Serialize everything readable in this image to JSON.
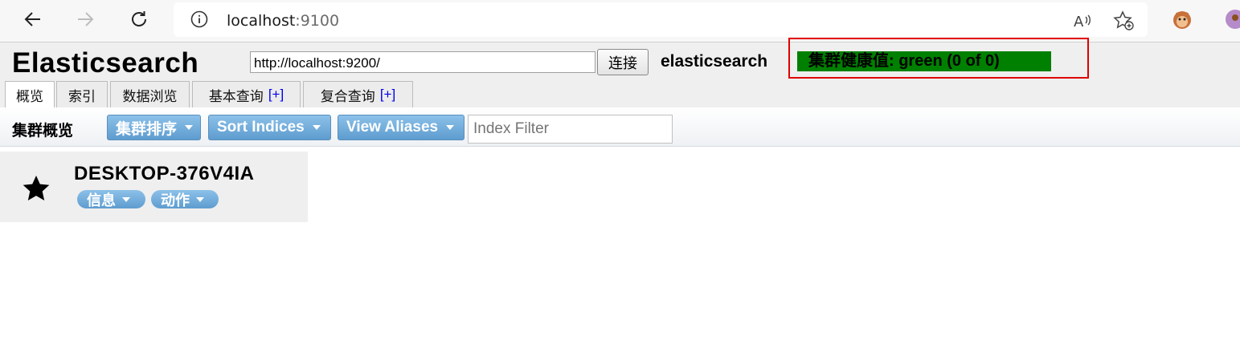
{
  "browser": {
    "url_host": "localhost",
    "url_port": ":9100"
  },
  "app": {
    "brand": "Elasticsearch",
    "connect_url": "http://localhost:9200/",
    "connect_label": "连接",
    "cluster_name": "elasticsearch",
    "health_text": "集群健康值: green (0 of 0)",
    "health_color": "#008000",
    "tabs": [
      {
        "label": "概览",
        "plus": ""
      },
      {
        "label": "索引",
        "plus": ""
      },
      {
        "label": "数据浏览",
        "plus": ""
      },
      {
        "label": "基本查询",
        "plus": "[+]"
      },
      {
        "label": "复合查询",
        "plus": "[+]"
      }
    ]
  },
  "toolbar": {
    "title": "集群概览",
    "sort_cluster": "集群排序",
    "sort_indices": "Sort Indices",
    "view_aliases": "View Aliases",
    "filter_placeholder": "Index Filter"
  },
  "node": {
    "name": "DESKTOP-376V4IA",
    "info_label": "信息",
    "action_label": "动作",
    "icon": "star-icon"
  },
  "colors": {
    "accent_button": "#6aa7d9",
    "highlight_border": "#e00000"
  }
}
